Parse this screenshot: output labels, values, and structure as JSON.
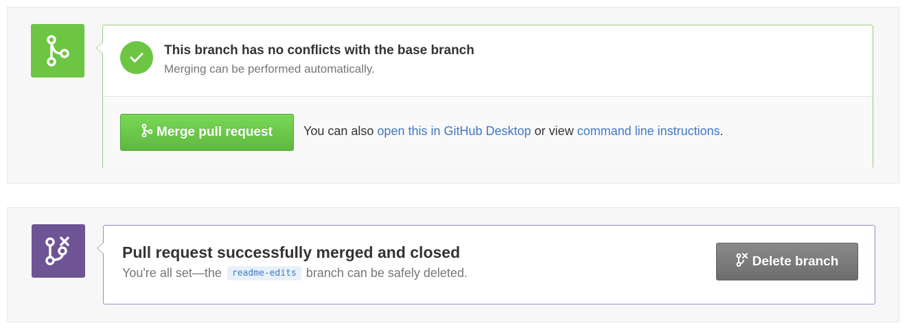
{
  "merge_panel": {
    "badge_icon": "git-merge-icon",
    "status_icon": "check-icon",
    "title": "This branch has no conflicts with the base branch",
    "subtitle": "Merging can be performed automatically.",
    "merge_button": {
      "icon": "git-merge-icon",
      "label": "Merge pull request"
    },
    "also_prefix": "You can also ",
    "desktop_link": "open this in GitHub Desktop",
    "also_middle": " or view ",
    "cli_link": "command line instructions",
    "also_suffix": ".",
    "colors": {
      "accent": "#6cc644",
      "link": "#4078c0"
    }
  },
  "merged_panel": {
    "badge_icon": "git-pull-request-closed-icon",
    "title": "Pull request successfully merged and closed",
    "subtitle_prefix": "You're all set—the",
    "branch_name": "readme-edits",
    "subtitle_suffix": "branch can be safely deleted.",
    "delete_button": {
      "icon": "git-branch-delete-icon",
      "label": "Delete branch"
    },
    "colors": {
      "accent": "#6e5494",
      "button": "#7a7a7a"
    }
  }
}
